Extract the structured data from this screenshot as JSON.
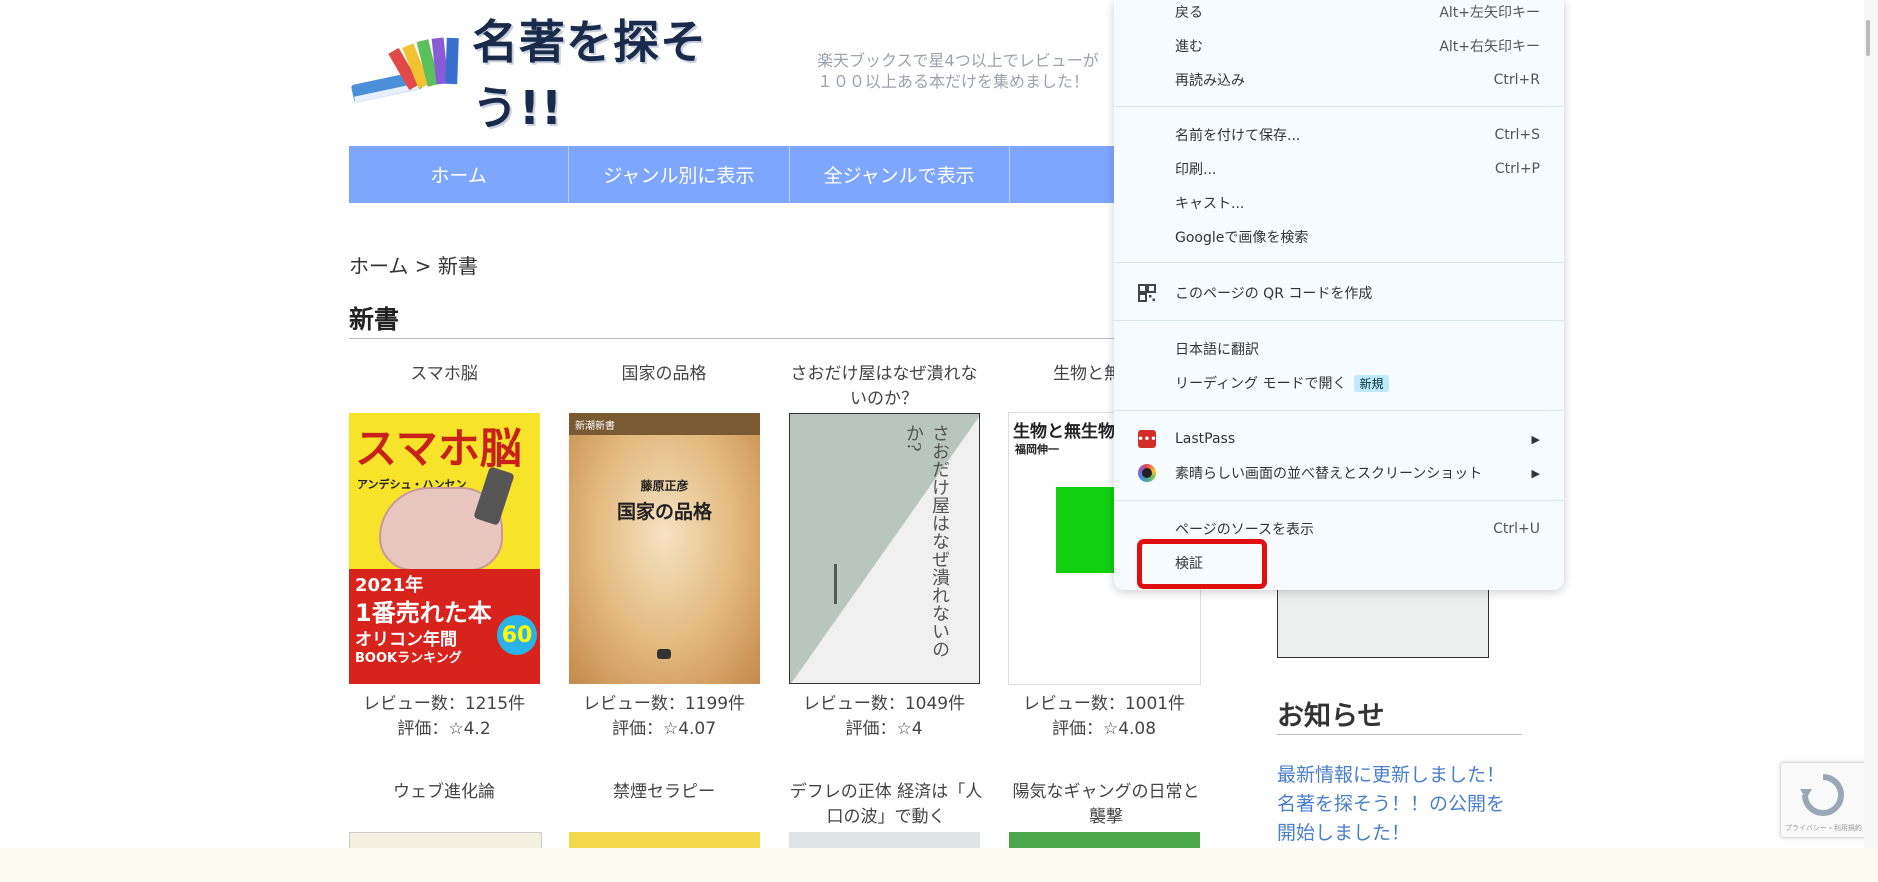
{
  "header": {
    "logo_text": "名著を探そう!!",
    "tagline_line1": "楽天ブックスで星4つ以上でレビューが",
    "tagline_line2": "１００以上ある本だけを集めました！"
  },
  "nav": {
    "items": [
      {
        "label": "ホーム"
      },
      {
        "label": "ジャンル別に表示"
      },
      {
        "label": "全ジャンルで表示"
      },
      {
        "label": ""
      }
    ]
  },
  "breadcrumb": "ホーム > 新書",
  "section_title": "新書",
  "books_row1": [
    {
      "title": "スマホ脳",
      "reviews": "レビュー数：1215件",
      "rating": "評価：☆4.2",
      "cover_title": "スマホ脳",
      "cover_author": "アンデシュ・ハンセン",
      "cover_tag1": "2021年",
      "cover_tag2": "1番売れた本",
      "cover_tag3": "オリコン年間",
      "cover_tag4": "BOOKランキング"
    },
    {
      "title": "国家の品格",
      "reviews": "レビュー数：1199件",
      "rating": "評価：☆4.07",
      "cover_title": "国家の品格",
      "cover_author": "藤原正彦",
      "cover_series": "新潮新書"
    },
    {
      "title": "さおだけ屋はなぜ潰れないのか？",
      "reviews": "レビュー数：1049件",
      "rating": "評価：☆4",
      "cover_title": "さおだけ屋はなぜ潰れないのか?"
    },
    {
      "title": "生物と無生物",
      "reviews": "レビュー数：1001件",
      "rating": "評価：☆4.08",
      "cover_title": "生物と無生物",
      "cover_author": "福岡伸一"
    }
  ],
  "books_row2": [
    {
      "title": "ウェブ進化論"
    },
    {
      "title": "禁煙セラピー"
    },
    {
      "title": "デフレの正体 経済は「人口の波」で動く"
    },
    {
      "title": "陽気なギャングの日常と襲撃"
    }
  ],
  "sidebar": {
    "notice_title": "お知らせ",
    "links": [
      "最新情報に更新しました！",
      "名著を探そう！！の公開を",
      "開始しました！"
    ]
  },
  "context_menu": {
    "items": [
      {
        "label": "戻る",
        "shortcut": "Alt+左矢印キー"
      },
      {
        "label": "進む",
        "shortcut": "Alt+右矢印キー"
      },
      {
        "label": "再読み込み",
        "shortcut": "Ctrl+R"
      },
      {
        "label": "名前を付けて保存...",
        "shortcut": "Ctrl+S"
      },
      {
        "label": "印刷...",
        "shortcut": "Ctrl+P"
      },
      {
        "label": "キャスト..."
      },
      {
        "label": "Googleで画像を検索"
      },
      {
        "label": "このページの QR コードを作成"
      },
      {
        "label": "日本語に翻訳"
      },
      {
        "label": "リーディング モードで開く",
        "badge": "新規"
      },
      {
        "label": "LastPass"
      },
      {
        "label": "素晴らしい画面の並べ替えとスクリーンショット"
      },
      {
        "label": "ページのソースを表示",
        "shortcut": "Ctrl+U"
      },
      {
        "label": "検証"
      }
    ]
  },
  "recaptcha": {
    "text": "プライバシー・利用規約"
  },
  "colors": {
    "nav_bg": "#7fa6ff",
    "link": "#4a7fc9",
    "highlight": "#e01010",
    "menu_bg": "#f5fbfe"
  }
}
